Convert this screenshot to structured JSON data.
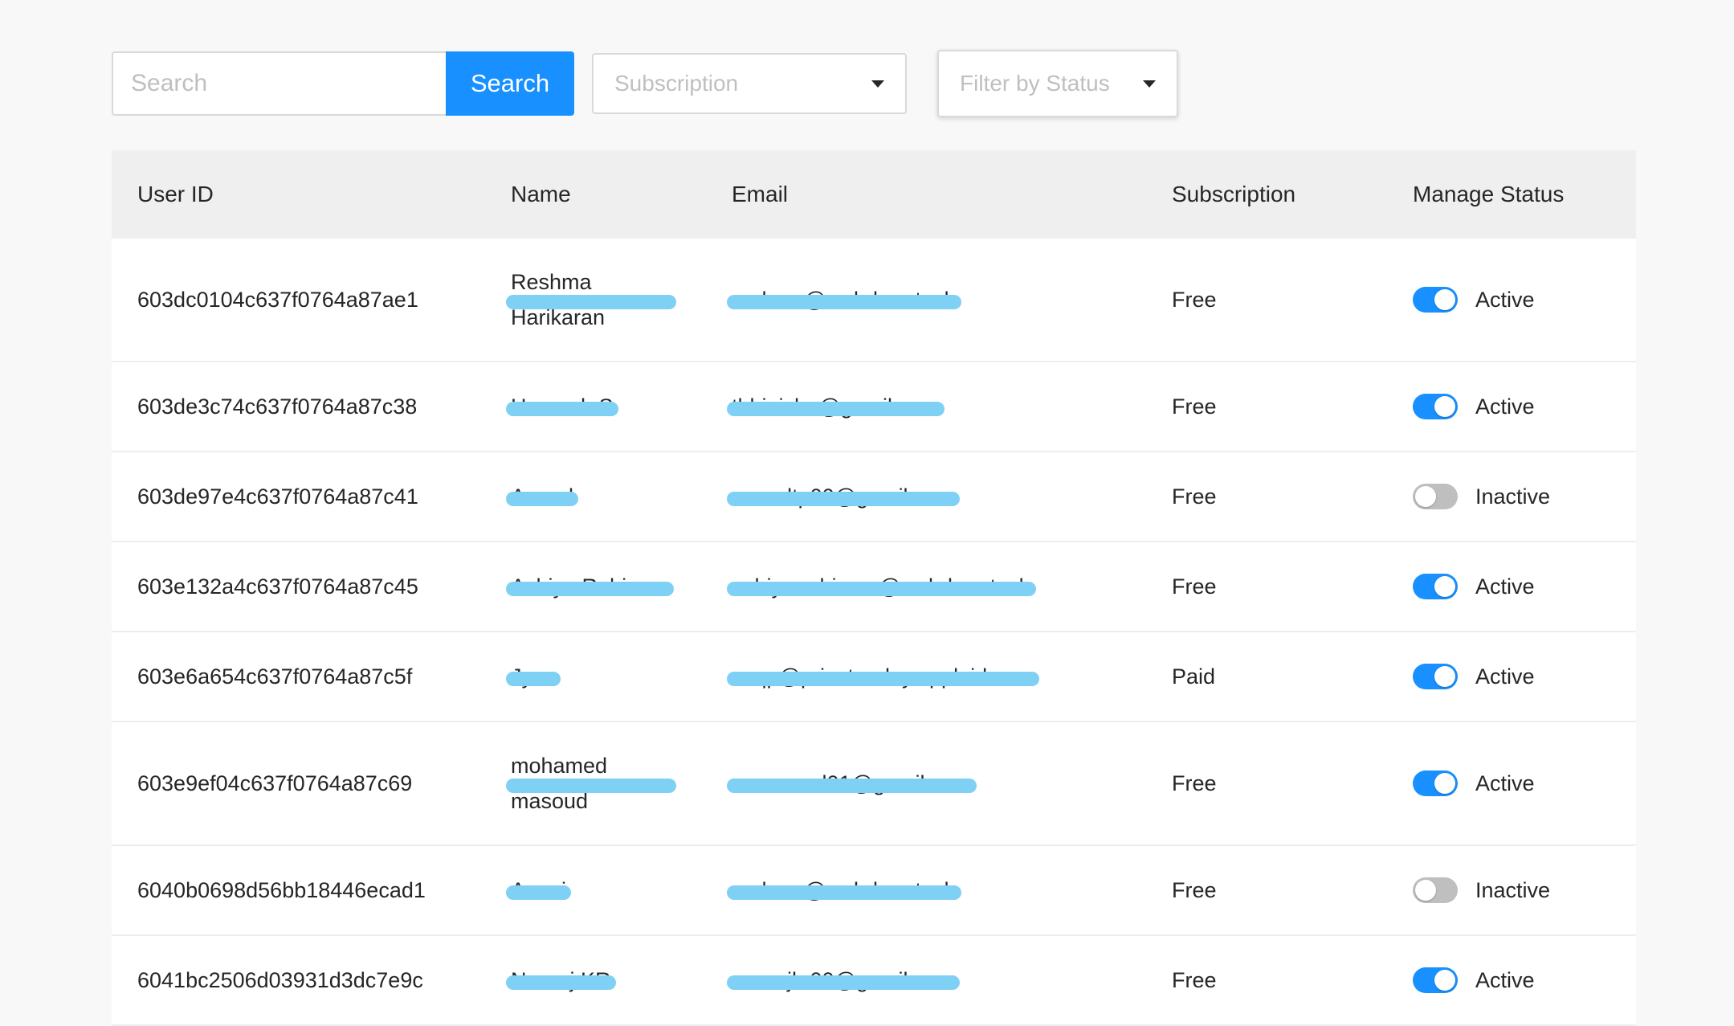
{
  "toolbar": {
    "search_placeholder": "Search",
    "search_button": "Search",
    "subscription_placeholder": "Subscription",
    "status_placeholder": "Filter by Status"
  },
  "table": {
    "headers": [
      "User ID",
      "Name",
      "Email",
      "Subscription",
      "Manage Status"
    ],
    "rows": [
      {
        "id": "603dc0104c637f0764a87ae1",
        "name": "Reshma Harikaran",
        "email": "reshma@webdura.tech",
        "subscription": "Free",
        "active": true,
        "status": "Active"
      },
      {
        "id": "603de3c74c637f0764a87c38",
        "name": "Hareesh S",
        "email": "thbinisha@gmail.com",
        "subscription": "Free",
        "active": true,
        "status": "Active"
      },
      {
        "id": "603de97e4c637f0764a87c41",
        "name": "Anand",
        "email": "anandtp00@gmail.com",
        "subscription": "Free",
        "active": false,
        "status": "Inactive"
      },
      {
        "id": "603e132a4c637f0764a87c45",
        "name": "Ashiya Rahiman",
        "email": "ashiya.rahiman@webdura.tech",
        "subscription": "Free",
        "active": true,
        "status": "Active"
      },
      {
        "id": "603e6a654c637f0764a87c5f",
        "name": "Jyes",
        "email": "voqp@privaterelay.appleid.com",
        "subscription": "Paid",
        "active": true,
        "status": "Active"
      },
      {
        "id": "603e9ef04c637f0764a87c69",
        "name": "mohamed masoud",
        "email": "mmasoud01@gmail.com",
        "subscription": "Free",
        "active": true,
        "status": "Active"
      },
      {
        "id": "6040b0698d56bb18446ecad1",
        "name": "Ammi",
        "email": "reshma@webdura.tech",
        "subscription": "Free",
        "active": false,
        "status": "Inactive"
      },
      {
        "id": "6041bc2506d03931d3dc7e9c",
        "name": "Neeraj KR",
        "email": "neerajkr00@gmail.com",
        "subscription": "Free",
        "active": true,
        "status": "Active"
      }
    ]
  },
  "colors": {
    "accent": "#1890ff",
    "redaction": "#7fd0f5",
    "switch_off": "#bfbfbf"
  }
}
